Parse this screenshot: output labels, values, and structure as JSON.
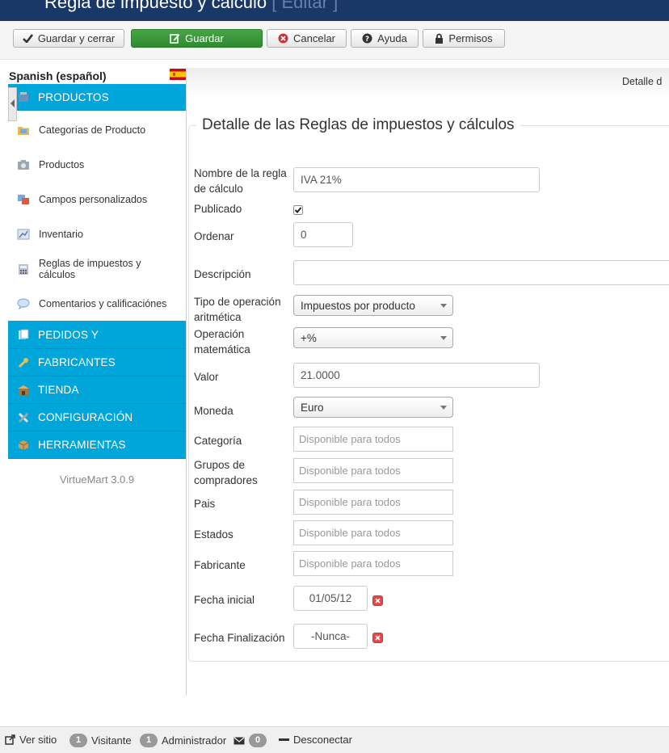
{
  "header": {
    "title": "Regla de impuesto y cálculo",
    "subtitle": "[ Editar ]"
  },
  "toolbar": {
    "save_close": "Guardar y cerrar",
    "save": "Guardar",
    "cancel": "Cancelar",
    "help": "Ayuda",
    "permissions": "Permisos"
  },
  "sidebar": {
    "language": "Spanish (español)",
    "products_head": "PRODUCTOS",
    "items": [
      "Categorías de Producto",
      "Productos",
      "Campos personalizados",
      "Inventario",
      "Reglas de impuestos y cálculos",
      "Comentarios y calificaciónes"
    ],
    "sections": [
      "PEDIDOS Y",
      "FABRICANTES",
      "TIENDA",
      "CONFIGURACIÓN",
      "HERRAMIENTAS"
    ],
    "version": "VirtueMart 3.0.9"
  },
  "tabs": {
    "detail": "Detalle d"
  },
  "form": {
    "legend": "Detalle de las Reglas de impuestos y cálculos",
    "name_label": "Nombre de la regla de cálculo",
    "name_value": "IVA 21%",
    "published_label": "Publicado",
    "published": true,
    "order_label": "Ordenar",
    "order_value": "0",
    "description_label": "Descripción",
    "description_value": "",
    "op_type_label": "Tipo de operación aritmética",
    "op_type_value": "Impuestos por producto",
    "math_label": "Operación matemática",
    "math_value": "+%",
    "value_label": "Valor",
    "value_value": "21.0000",
    "currency_label": "Moneda",
    "currency_value": "Euro",
    "category_label": "Categoría",
    "groups_label": "Grupos de compradores",
    "country_label": "Pais",
    "states_label": "Estados",
    "manufacturer_label": "Fabricante",
    "available_placeholder": "Disponible para todos",
    "start_label": "Fecha inicial",
    "start_value": "01/05/12",
    "end_label": "Fecha Finalización",
    "end_value": "-Nunca-"
  },
  "status": {
    "view_site": "Ver sitio",
    "visitors_count": "1",
    "visitors": "Visitante",
    "admins_count": "1",
    "admins": "Administrador",
    "messages_count": "0",
    "logout": "Desconectar"
  },
  "colors": {
    "header": "#1a3867",
    "menu": "#00a6d9",
    "save_green": "#3b9a3b"
  }
}
